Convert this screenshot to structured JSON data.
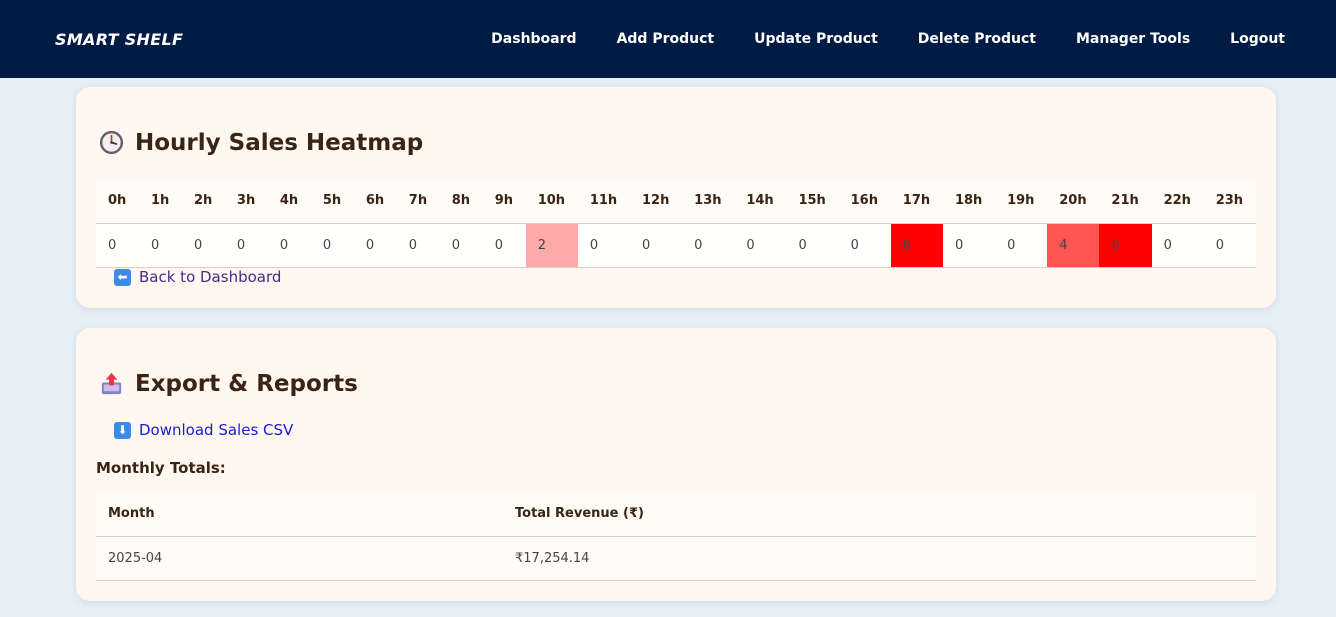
{
  "nav": {
    "brand": "SMART SHELF",
    "links": [
      "Dashboard",
      "Add Product",
      "Update Product",
      "Delete Product",
      "Manager Tools",
      "Logout"
    ]
  },
  "heatmap": {
    "title": "Hourly Sales Heatmap",
    "title_icon": "clock-icon",
    "hours": [
      "0h",
      "1h",
      "2h",
      "3h",
      "4h",
      "5h",
      "6h",
      "7h",
      "8h",
      "9h",
      "10h",
      "11h",
      "12h",
      "13h",
      "14h",
      "15h",
      "16h",
      "17h",
      "18h",
      "19h",
      "20h",
      "21h",
      "22h",
      "23h"
    ],
    "values": [
      0,
      0,
      0,
      0,
      0,
      0,
      0,
      0,
      0,
      0,
      2,
      0,
      0,
      0,
      0,
      0,
      0,
      6,
      0,
      0,
      4,
      6,
      0,
      0
    ],
    "colors": {
      "2": "#ffaaaa",
      "4": "#ff5555",
      "6": "#ff0000"
    },
    "back_link": "Back to Dashboard",
    "back_icon": "left-arrow-icon"
  },
  "export": {
    "title": "Export & Reports",
    "title_icon": "outbox-tray-icon",
    "download_link": "Download Sales CSV",
    "download_icon": "down-arrow-icon",
    "monthly_label": "Monthly Totals:",
    "columns": [
      "Month",
      "Total Revenue (₹)"
    ],
    "rows": [
      {
        "month": "2025-04",
        "revenue": "₹17,254.14"
      }
    ]
  }
}
